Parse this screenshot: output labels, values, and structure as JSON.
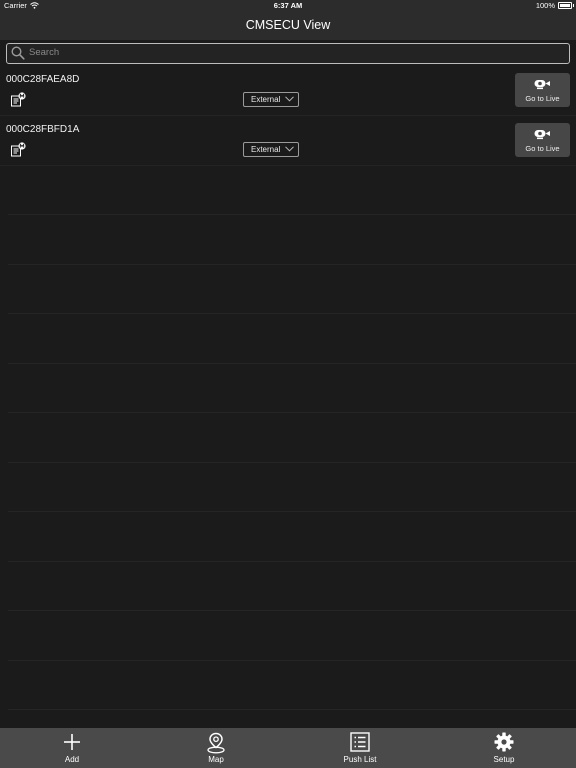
{
  "status_bar": {
    "carrier": "Carrier",
    "time": "6:37 AM",
    "battery": "100%"
  },
  "nav": {
    "title": "CMSECU View"
  },
  "search": {
    "placeholder": "Search",
    "value": ""
  },
  "devices": [
    {
      "name": "000C28FAEA8D",
      "mode": "External",
      "live_label": "Go to Live"
    },
    {
      "name": "000C28FBFD1A",
      "mode": "External",
      "live_label": "Go to Live"
    }
  ],
  "tabs": [
    {
      "label": "Add",
      "icon": "plus-icon"
    },
    {
      "label": "Map",
      "icon": "map-pin-icon"
    },
    {
      "label": "Push List",
      "icon": "list-icon"
    },
    {
      "label": "Setup",
      "icon": "gear-icon"
    }
  ],
  "colors": {
    "background": "#1b1b1b",
    "bar": "#2c2c2c",
    "tab_bar": "#4a4a4a",
    "button": "#474747"
  }
}
